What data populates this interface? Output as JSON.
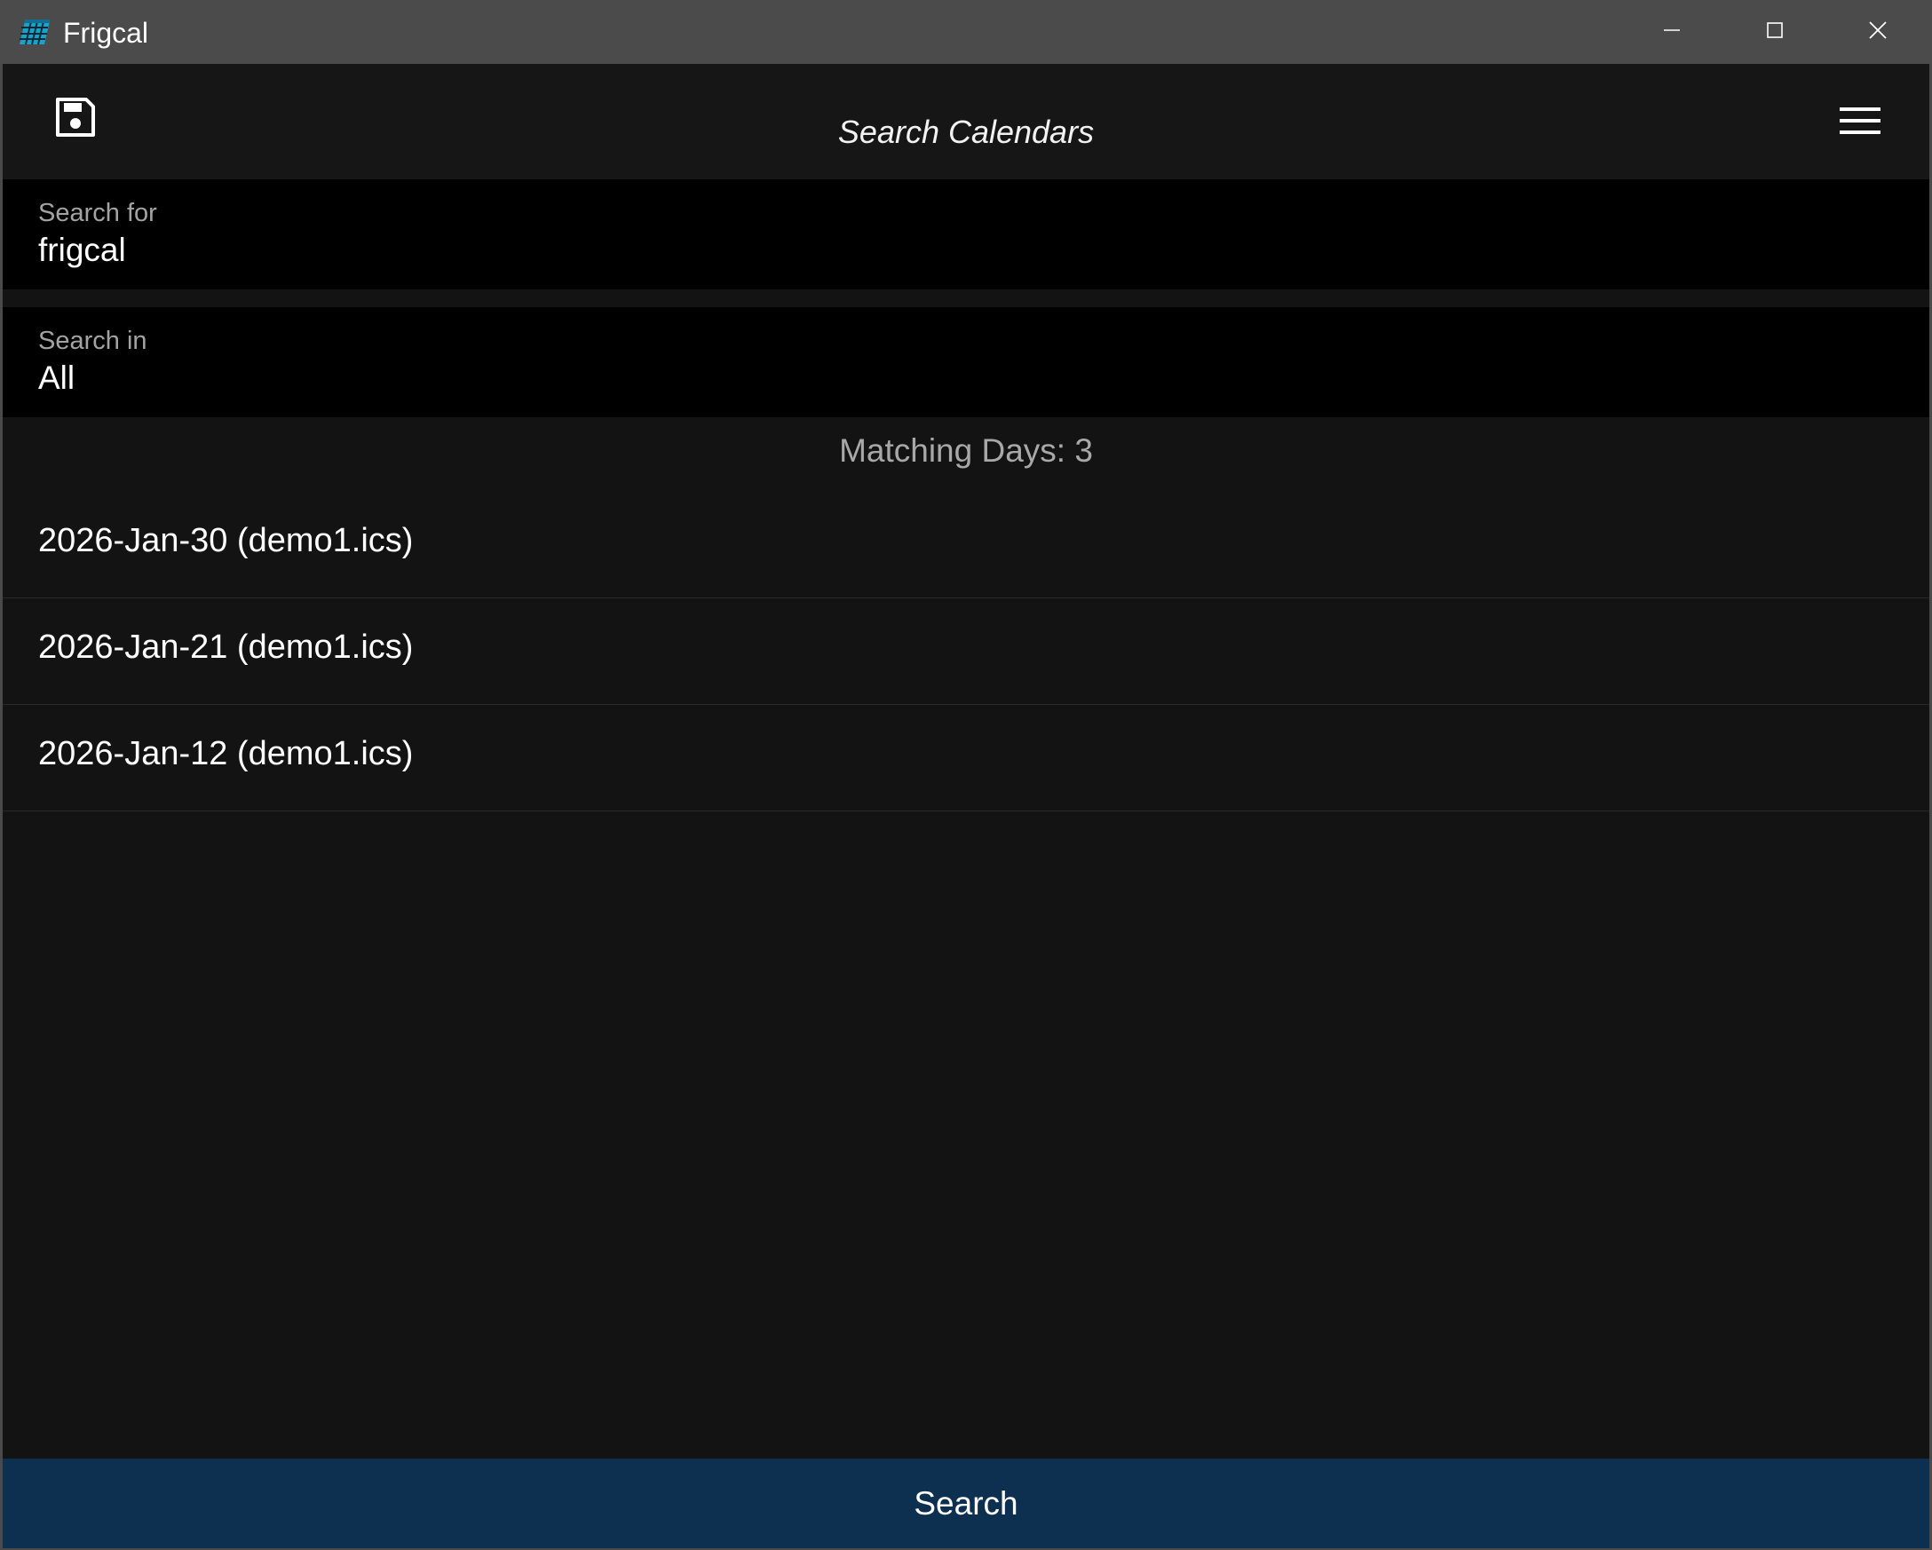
{
  "window": {
    "title": "Frigcal",
    "app_icon": "calendar-grid-icon",
    "controls": [
      "minimize-icon",
      "maximize-icon",
      "close-icon"
    ]
  },
  "header": {
    "title": "Search Calendars",
    "save_icon": "save-icon",
    "menu_icon": "hamburger-menu-icon"
  },
  "search_for": {
    "label": "Search for",
    "value": "frigcal"
  },
  "search_in": {
    "label": "Search in",
    "value": "All"
  },
  "results": {
    "summary": "Matching Days: 3",
    "items": [
      {
        "label": "2026-Jan-30 (demo1.ics)"
      },
      {
        "label": "2026-Jan-21 (demo1.ics)"
      },
      {
        "label": "2026-Jan-12 (demo1.ics)"
      }
    ]
  },
  "footer": {
    "search_label": "Search"
  },
  "colors": {
    "titlebar": "#4b4b4b",
    "background": "#131313",
    "field_background": "#000000",
    "search_button": "#0d3050",
    "muted_text": "#a3a3a3"
  }
}
